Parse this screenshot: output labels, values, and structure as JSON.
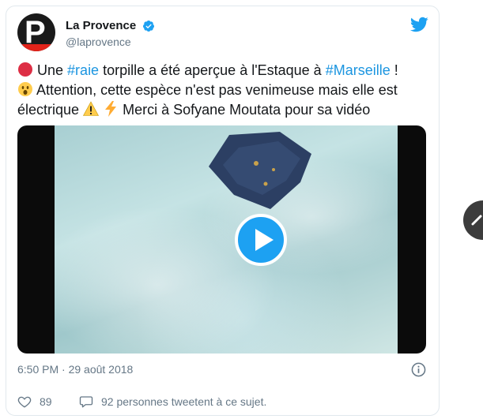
{
  "tweet": {
    "author": {
      "display_name": "La Provence",
      "handle": "@laprovence",
      "avatar_letter": "P"
    },
    "text": {
      "line1_prefix": "Une ",
      "hashtag1": "#raie",
      "line1_middle": " torpille a été aperçue à l'Estaque à ",
      "hashtag2": "#Marseille",
      "line1_suffix": " !",
      "line2": "Attention, cette espèce n'est pas venimeuse mais elle est",
      "line3_prefix": "électrique",
      "line3_suffix": "Merci à Sofyane Moutata pour sa vidéo"
    },
    "timestamp": "6:50 PM · 29 août 2018",
    "likes_count": "89",
    "replies_text": "92 personnes tweetent à ce sujet."
  },
  "colors": {
    "hashtag": "#1b95e0",
    "twitter_blue": "#1da1f2",
    "secondary_text": "#657786",
    "brand_red": "#e2231a"
  },
  "icons": {
    "verified": "verified-badge-icon",
    "logo": "twitter-bird-icon",
    "play": "play-icon",
    "info": "info-icon",
    "like": "heart-icon",
    "reply": "speech-bubble-icon",
    "red_circle": "red-circle-emoji",
    "surprised": "surprised-face-emoji",
    "warning": "warning-emoji",
    "lightning": "lightning-emoji"
  }
}
